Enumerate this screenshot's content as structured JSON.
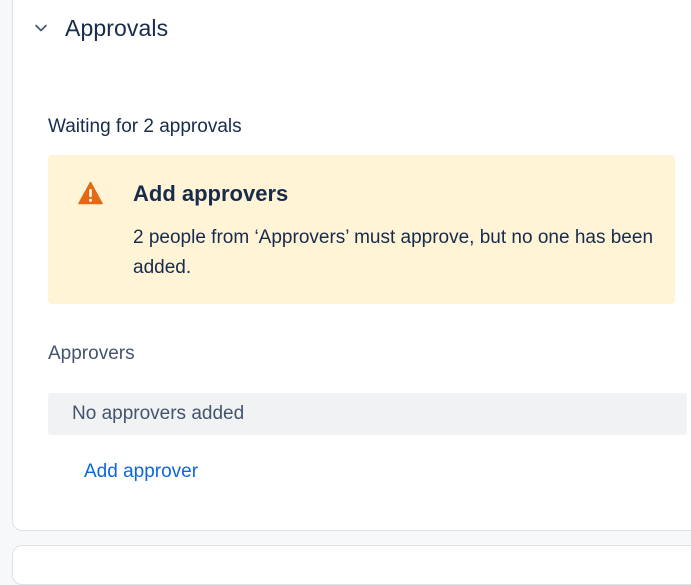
{
  "section": {
    "title": "Approvals",
    "chevron_icon": "chevron-down-icon"
  },
  "status": {
    "waiting_text": "Waiting for 2 approvals"
  },
  "warning": {
    "icon": "warning-icon",
    "title": "Add approvers",
    "body": "2 people from ‘Approvers’ must approve, but no one has been added."
  },
  "approvers": {
    "label": "Approvers",
    "empty_text": "No approvers added",
    "add_link": "Add approver"
  },
  "colors": {
    "warning_bg": "#fff4d6",
    "warning_icon": "#e56910",
    "link": "#0c66e4",
    "empty_bg": "#f1f2f4"
  }
}
